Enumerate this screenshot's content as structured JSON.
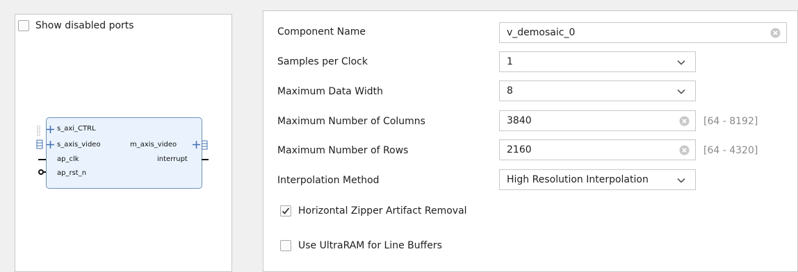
{
  "left": {
    "show_disabled_ports": "Show disabled ports",
    "ports": {
      "s_axi_ctrl": "s_axi_CTRL",
      "s_axis_video": "s_axis_video",
      "m_axis_video": "m_axis_video",
      "ap_clk": "ap_clk",
      "interrupt": "interrupt",
      "ap_rst_n": "ap_rst_n"
    }
  },
  "form": {
    "component_name": {
      "label": "Component Name",
      "value": "v_demosaic_0"
    },
    "samples_per_clock": {
      "label": "Samples per Clock",
      "value": "1"
    },
    "max_data_width": {
      "label": "Maximum Data Width",
      "value": "8"
    },
    "max_columns": {
      "label": "Maximum Number of Columns",
      "value": "3840",
      "range": "[64 - 8192]"
    },
    "max_rows": {
      "label": "Maximum Number of Rows",
      "value": "2160",
      "range": "[64 - 4320]"
    },
    "interpolation": {
      "label": "Interpolation Method",
      "value": "High Resolution Interpolation"
    },
    "zipper": {
      "label": "Horizontal Zipper Artifact Removal",
      "checked": true
    },
    "ultraram": {
      "label": "Use UltraRAM for Line Buffers",
      "checked": false
    }
  },
  "colors": {
    "block_fill": "#eaf3fd",
    "block_border": "#6f8fb8",
    "range_text": "#8a8a8a"
  }
}
